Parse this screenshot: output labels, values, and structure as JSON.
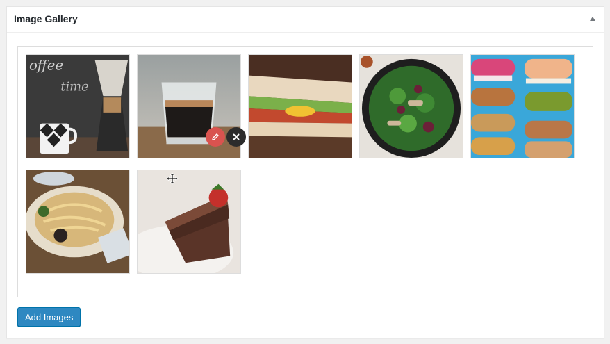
{
  "metabox": {
    "title": "Image Gallery",
    "toggle_icon": "triangle-up-icon"
  },
  "gallery": {
    "images": [
      {
        "name": "coffee-chemex-image",
        "alt": "coffee"
      },
      {
        "name": "espresso-glass-image",
        "alt": "espresso"
      },
      {
        "name": "sandwich-image",
        "alt": "sandwich"
      },
      {
        "name": "salad-bowl-image",
        "alt": "salad"
      },
      {
        "name": "macarons-image",
        "alt": "macarons"
      },
      {
        "name": "pasta-bowl-image",
        "alt": "pasta"
      },
      {
        "name": "chocolate-cake-image",
        "alt": "cake"
      }
    ],
    "hover_actions": {
      "edit_icon": "pencil-icon",
      "remove_icon": "close-icon",
      "drag_icon": "move-icon"
    }
  },
  "buttons": {
    "add_images_label": "Add Images"
  },
  "colors": {
    "edit": "#d9534f",
    "remove": "#2c2c2c",
    "primary": "#2e88c1"
  }
}
